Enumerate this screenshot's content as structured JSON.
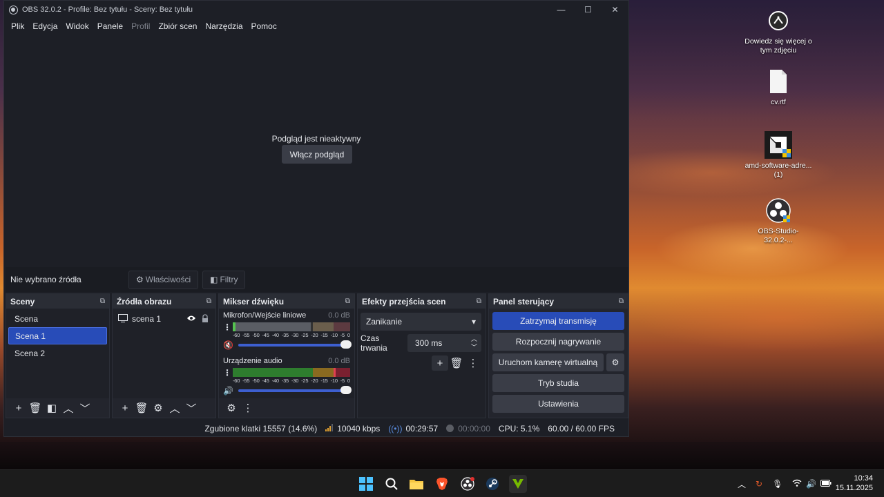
{
  "window": {
    "title": "OBS 32.0.2 - Profile: Bez tytułu - Sceny: Bez tytułu",
    "controls": {
      "minimize": "—",
      "maximize": "☐",
      "close": "✕"
    }
  },
  "menu": [
    "Plik",
    "Edycja",
    "Widok",
    "Panele",
    "Profil",
    "Zbiór scen",
    "Narzędzia",
    "Pomoc"
  ],
  "preview": {
    "message": "Podgląd jest nieaktywny",
    "enable_button": "Włącz podgląd"
  },
  "source_bar": {
    "no_source": "Nie wybrano źródła",
    "properties": "Właściwości",
    "filters": "Filtry"
  },
  "docks": {
    "scenes": {
      "title": "Sceny",
      "items": [
        "Scena",
        "Scena 1",
        "Scena 2"
      ],
      "selected": "Scena 1"
    },
    "sources": {
      "title": "Źródła obrazu",
      "items": [
        "scena 1"
      ]
    },
    "mixer": {
      "title": "Mikser dźwięku",
      "channels": [
        {
          "name": "Mikrofon/Wejście liniowe",
          "db": "0.0 dB",
          "muted": true
        },
        {
          "name": "Urządzenie audio",
          "db": "0.0 dB",
          "muted": false
        }
      ],
      "scale": [
        "-60",
        "-55",
        "-50",
        "-45",
        "-40",
        "-35",
        "-30",
        "-25",
        "-20",
        "-15",
        "-10",
        "-5",
        "0"
      ]
    },
    "transitions": {
      "title": "Efekty przejścia scen",
      "selected": "Zanikanie",
      "duration_label": "Czas trwania",
      "duration_value": "300 ms"
    },
    "controls": {
      "title": "Panel sterujący",
      "stop_stream": "Zatrzymaj transmisję",
      "start_recording": "Rozpocznij nagrywanie",
      "virtual_cam": "Uruchom kamerę wirtualną",
      "studio_mode": "Tryb studia",
      "settings": "Ustawienia"
    }
  },
  "status": {
    "dropped_frames": "Zgubione klatki 15557 (14.6%)",
    "bitrate": "10040 kbps",
    "stream_time": "00:29:57",
    "record_time": "00:00:00",
    "cpu": "CPU: 5.1%",
    "fps": "60.00 / 60.00 FPS"
  },
  "desktop_icons": [
    {
      "label": "Dowiedz się więcej o tym zdjęciu",
      "icon": "info-camera-icon"
    },
    {
      "label": "cv.rtf",
      "icon": "document-icon"
    },
    {
      "label": "amd-software-adre... (1)",
      "icon": "amd-installer-icon"
    },
    {
      "label": "OBS-Studio-32.0.2-...",
      "icon": "obs-installer-icon"
    }
  ],
  "taskbar": {
    "time": "10:34",
    "date": "15.11.2025"
  },
  "colors": {
    "accent": "#284cb8",
    "window_bg": "#1d1f26",
    "dock_bg": "#23252d"
  }
}
